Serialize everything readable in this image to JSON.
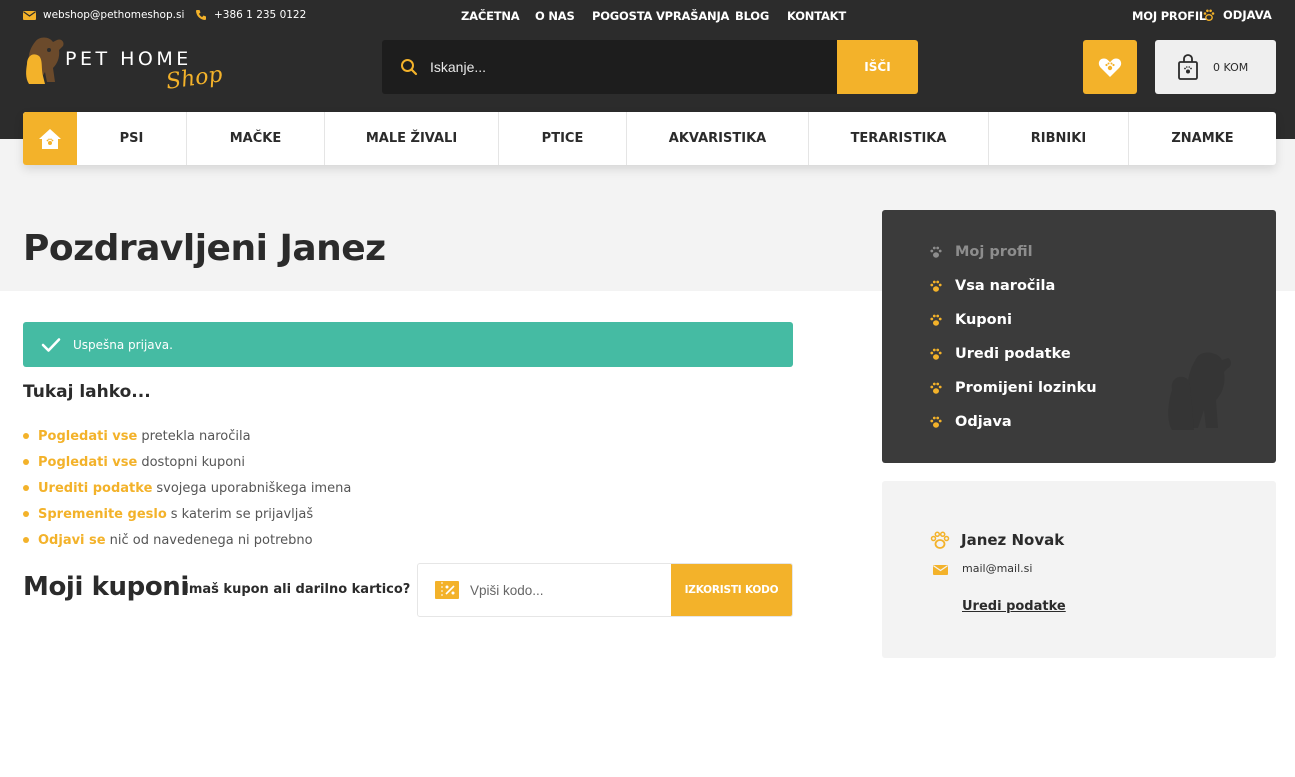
{
  "topbar": {
    "email": "webshop@pethomeshop.si",
    "phone": "+386 1 235 0122",
    "nav": [
      "ZAČETNA",
      "O NAS",
      "POGOSTA VPRAŠANJA",
      "BLOG",
      "KONTAKT"
    ],
    "my_profile": "MOJ PROFIL",
    "logout": "ODJAVA"
  },
  "logo": {
    "line1": "PET HOME",
    "line2": "Shop"
  },
  "search": {
    "placeholder": "Iskanje...",
    "button": "IŠČI"
  },
  "cart": {
    "label": "0 KOM"
  },
  "categories": [
    "PSI",
    "MAČKE",
    "MALE ŽIVALI",
    "PTICE",
    "AKVARISTIKA",
    "TERARISTIKA",
    "RIBNIKI",
    "ZNAMKE"
  ],
  "main": {
    "title": "Pozdravljeni Janez",
    "alert": "Uspešna prijava.",
    "subhead": "Tukaj lahko...",
    "actions": [
      {
        "link": "Pogledati vse",
        "text": "pretekla naročila"
      },
      {
        "link": "Pogledati vse",
        "text": "dostopni kuponi"
      },
      {
        "link": "Urediti podatke",
        "text": "svojega uporabniškega imena"
      },
      {
        "link": "Spremenite geslo",
        "text": "s katerim se prijavljaš"
      },
      {
        "link": "Odjavi se",
        "text": "nič od navedenega ni potrebno"
      }
    ],
    "coupons_title": "Moji kuponi",
    "coupons_question": "Imaš kupon ali darilno kartico?",
    "coupon_placeholder": "Vpiši kodo...",
    "coupon_button": "IZKORISTI KODO"
  },
  "sidebar": {
    "menu": [
      "Moj profil",
      "Vsa naročila",
      "Kuponi",
      "Uredi podatke",
      "Promijeni lozinku",
      "Odjava"
    ],
    "active_index": 0
  },
  "profile": {
    "name": "Janez Novak",
    "email": "mail@mail.si",
    "edit": "Uredi podatke"
  },
  "colors": {
    "accent": "#f3b22a",
    "header": "#2c2c2c",
    "success": "#45bba3",
    "sidebar": "#3b3b3b"
  },
  "icons": [
    "mail-icon",
    "phone-icon",
    "paw-icon",
    "search-icon",
    "heart-icon",
    "bag-icon",
    "home-icon",
    "check-icon",
    "coupon-icon"
  ]
}
